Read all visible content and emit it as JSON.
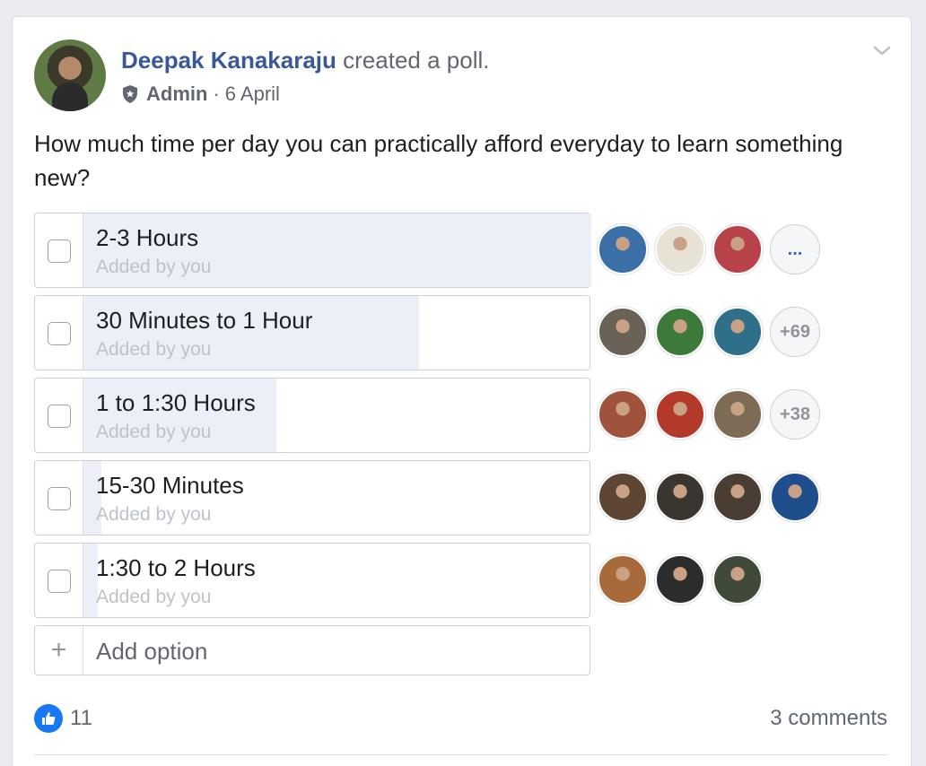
{
  "post": {
    "author_name": "Deepak Kanakaraju",
    "action": "created a poll.",
    "role": "Admin",
    "separator": "·",
    "date": "6 April",
    "question": "How much time per day you can practically afford everyday to learn something new?"
  },
  "poll": {
    "options": [
      {
        "label": "2-3 Hours",
        "added_by": "Added by you",
        "vote_share": 1.0,
        "voter_colors": [
          "#3b6fa8",
          "#e8e2d4",
          "#b8424a"
        ],
        "more_label": "..."
      },
      {
        "label": "30 Minutes to 1 Hour",
        "added_by": "Added by you",
        "vote_share": 0.66,
        "voter_colors": [
          "#6b6257",
          "#3d7a3a",
          "#2f6f8a"
        ],
        "more_label": "+69"
      },
      {
        "label": "1 to 1:30 Hours",
        "added_by": "Added by you",
        "vote_share": 0.38,
        "voter_colors": [
          "#a0533c",
          "#b33a2b",
          "#7d6b55"
        ],
        "more_label": "+38"
      },
      {
        "label": "15-30 Minutes",
        "added_by": "Added by you",
        "vote_share": 0.035,
        "voter_colors": [
          "#5d4633",
          "#3a352f",
          "#4a3d33",
          "#1f4e8c"
        ],
        "more_label": ""
      },
      {
        "label": "1:30 to 2 Hours",
        "added_by": "Added by you",
        "vote_share": 0.028,
        "voter_colors": [
          "#a86a3b",
          "#2c2c2c",
          "#3f4a3a"
        ],
        "more_label": ""
      }
    ],
    "add_option_label": "Add option",
    "add_option_icon": "+"
  },
  "footer": {
    "like_count": "11",
    "comments": "3 comments"
  },
  "colors": {
    "link_blue": "#385898",
    "like_blue": "#1877f2",
    "fill": "#ebeff7"
  }
}
